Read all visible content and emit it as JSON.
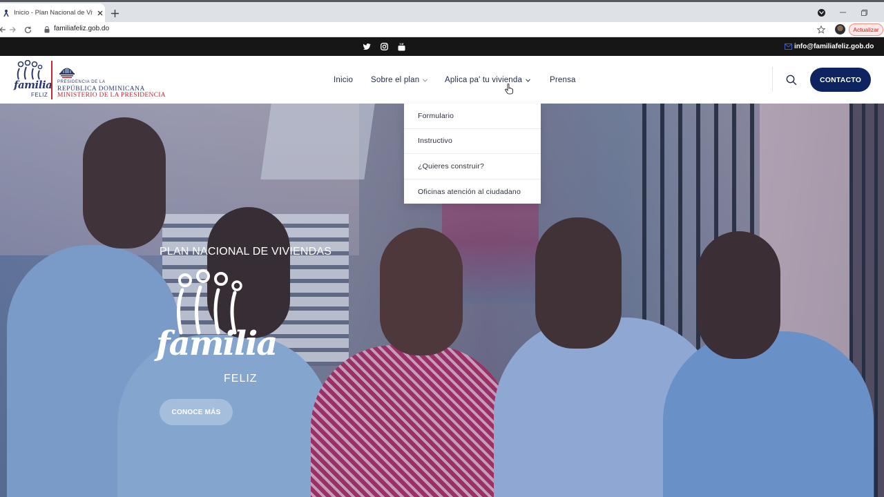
{
  "browser": {
    "tab_title": "Inicio - Plan Nacional de Viviendas",
    "url": "familiafeliz.gob.do",
    "update_label": "Actualizar"
  },
  "topbar": {
    "email": "info@familiafeliz.gob.do",
    "socials": [
      "twitter-icon",
      "instagram-icon",
      "youtube-icon"
    ]
  },
  "header": {
    "logo": {
      "word": "familia",
      "feliz": "FELIZ"
    },
    "gov": {
      "line1": "PRESIDENCIA DE LA",
      "line2": "REPÚBLICA DOMINICANA",
      "line3": "MINISTERIO DE LA PRESIDENCIA"
    },
    "nav": [
      {
        "label": "Inicio"
      },
      {
        "label": "Sobre el plan"
      },
      {
        "label": "Aplica pa' tu vivienda"
      },
      {
        "label": "Prensa"
      }
    ],
    "contact_label": "CONTACTO"
  },
  "dropdown": {
    "items": [
      "Formulario",
      "Instructivo",
      "¿Quieres construir?",
      "Oficinas atención al ciudadano"
    ]
  },
  "hero": {
    "kicker": "PLAN NACIONAL DE VIVIENDAS",
    "logo_word": "familia",
    "logo_feliz": "FELIZ",
    "cta_label": "CONOCE MÁS"
  },
  "colors": {
    "navy": "#0d2461",
    "brand_red": "#c6262e",
    "topbar": "#161616"
  }
}
